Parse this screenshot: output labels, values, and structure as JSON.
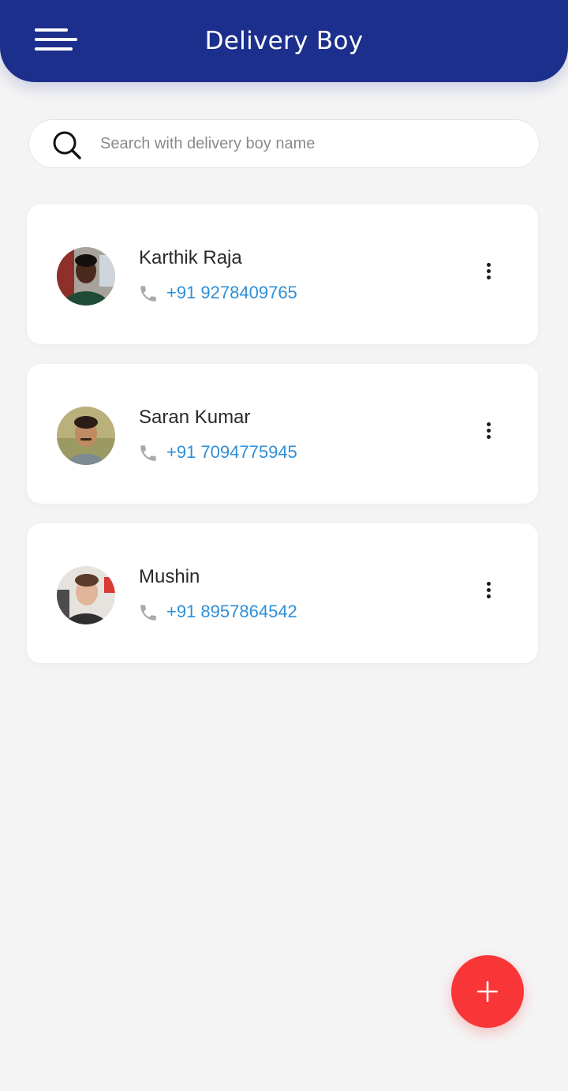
{
  "header": {
    "title": "Delivery Boy",
    "menu_icon": "hamburger-menu-icon",
    "background_color": "#1c2f8c"
  },
  "search": {
    "placeholder": "Search with delivery boy name",
    "value": "",
    "icon": "search-icon"
  },
  "delivery_boys": [
    {
      "name": "Karthik Raja",
      "phone": "+91 9278409765"
    },
    {
      "name": "Saran Kumar",
      "phone": "+91 7094775945"
    },
    {
      "name": "Mushin",
      "phone": "+91 8957864542"
    }
  ],
  "icons": {
    "phone": "phone-icon",
    "more": "more-vertical-icon",
    "add": "plus-icon"
  },
  "colors": {
    "accent": "#1c2f8c",
    "phone_text": "#2f8fd8",
    "fab": "#f83537",
    "background": "#f4f4f5"
  }
}
